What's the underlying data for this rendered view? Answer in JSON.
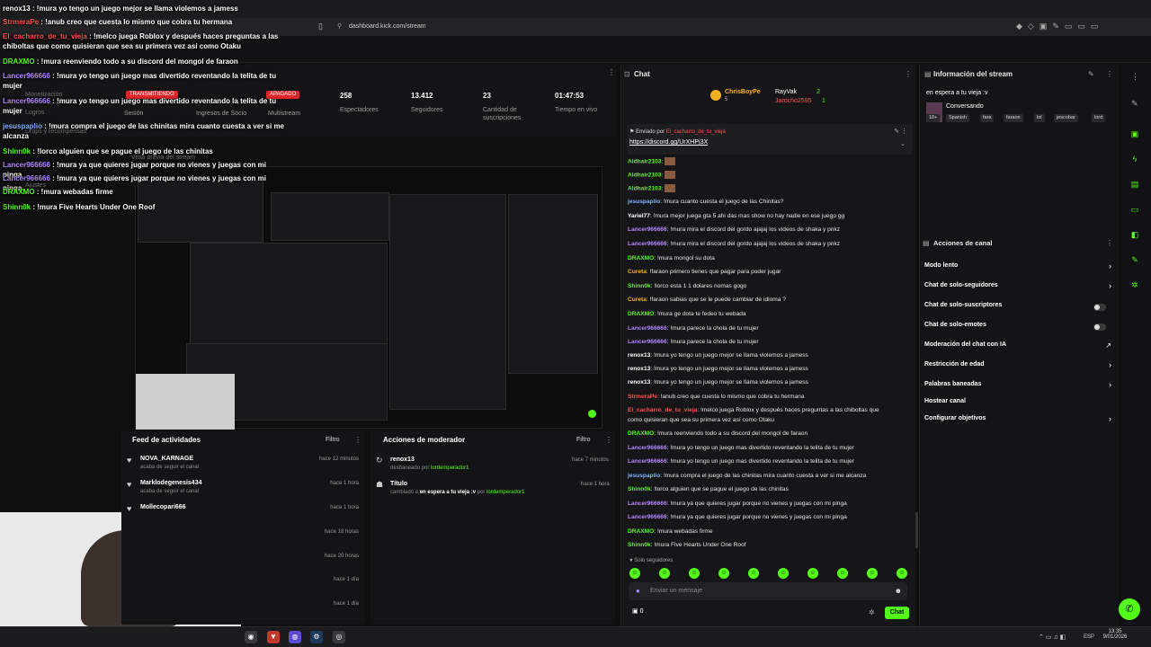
{
  "browser": {
    "url": "dashboard.kick.com/stream",
    "clock_time": "13:35",
    "clock_date": "9/01/2026",
    "lang": "ESP"
  },
  "sidebar_faded": {
    "items": [
      "Monetización",
      "Logros",
      "Drops y recompensas",
      "Vista previa del stream",
      "Ajustes"
    ]
  },
  "stats": {
    "badge_live": "TRANSMITIENDO",
    "badge_off": "APAGADO",
    "items": [
      {
        "value": "258",
        "label": "Espectadores"
      },
      {
        "value": "13.412",
        "label": "Seguidores"
      },
      {
        "value": "23",
        "label": "Cantidad de suscripciones"
      },
      {
        "value": "01:47:53",
        "label": "Tiempo en vivo"
      }
    ],
    "left_labels": [
      "Sesión",
      "Ingresos de Socio",
      "Multistream"
    ]
  },
  "overlay_chat": [
    {
      "user": "renox13",
      "text": "!mura yo tengo un juego mejor se llama violemos a jamess",
      "color": "#ffffff"
    },
    {
      "user": "StrmeraPe",
      "text": "!anub creo que cuesta lo mismo que cobra tu hermana",
      "color": "#ff5050"
    },
    {
      "user": "El_cacharro_de_tu_vieja",
      "text": "!melco juega Roblox y después haces preguntas a las chiboltas que como quisieran que sea su primera vez así como Otaku",
      "color": "#ff5050"
    },
    {
      "user": "DRAXMO",
      "text": "!mura reenviendo todo a su discord del mongol de faraon",
      "color": "#53fc18"
    },
    {
      "user": "Lancer966666",
      "text": "!mura yo tengo un juego mas divertido reventando la telita de tu mujer",
      "color": "#b388ff"
    },
    {
      "user": "Lancer966666",
      "text": "!mura yo tengo un juego mas divertido reventando la telita de tu mujer",
      "color": "#b388ff"
    },
    {
      "user": "jesuspaplio",
      "text": "!mura compra el juego de las chinitas mira cuanto cuesta a ver si me alcanza",
      "color": "#7fb3ff"
    },
    {
      "user": "Shinn0k",
      "text": "!lorco alguien que se pague el juego de las chinitas",
      "color": "#53fc18"
    },
    {
      "user": "Lancer966666",
      "text": "!mura ya que quieres jugar porque no vienes y juegas con mi pinga",
      "color": "#b388ff"
    },
    {
      "user": "Lancer966666",
      "text": "!mura ya que quieres jugar porque no vienes y juegas con mi pinga",
      "color": "#b388ff"
    },
    {
      "user": "DRAXMO",
      "text": "!mura webadas firme",
      "color": "#53fc18"
    },
    {
      "user": "Shinn0k",
      "text": "!mura Five Hearts Under One Roof",
      "color": "#53fc18"
    }
  ],
  "activity": {
    "title": "Feed de actividades",
    "filter": "Filtro",
    "rows": [
      {
        "name": "NOVA_KARNAGE",
        "sub": "acaba de seguir el canal",
        "time": "hace 12 minutos"
      },
      {
        "name": "Marklodegenesis434",
        "sub": "acaba de seguir el canal",
        "time": "hace 1 hora"
      },
      {
        "name": "Mollecopari666",
        "sub": "",
        "time": "hace 1 hora"
      },
      {
        "name": "",
        "sub": "",
        "time": "hace 18 horas"
      },
      {
        "name": "",
        "sub": "",
        "time": "hace 20 horas"
      },
      {
        "name": "",
        "sub": "",
        "time": "hace 1 día"
      },
      {
        "name": "",
        "sub": "",
        "time": "hace 1 día"
      }
    ]
  },
  "modactions": {
    "title": "Acciones de moderador",
    "filter": "Filtro",
    "rows": [
      {
        "name": "renox13",
        "sub_prefix": "desbaneado por",
        "sub_user": "lordemperador1",
        "time": "hace 7 minutos"
      },
      {
        "name": "Título",
        "sub_prefix": "cambiado a",
        "sub_value": "en espera a tu vieja :v",
        "sub_by": "por",
        "sub_user": "lordemperador1",
        "time": "hace 1 hora"
      }
    ]
  },
  "chat": {
    "title": "Chat",
    "top_users": [
      {
        "name": "ChrisBoyPe",
        "count": "5"
      },
      {
        "name": "RayVak",
        "count": "2"
      },
      {
        "name": "Jarocho2595",
        "count": "1"
      }
    ],
    "pinned_label": "Enviado por",
    "pinned_user": "El_cacharro_de_tu_vieja",
    "pinned_link": "https://discord.gg/UrXHPj3X",
    "messages": [
      {
        "user": "Aldhair2103",
        "text": "",
        "color": "#53fc18"
      },
      {
        "user": "Aldhair2103",
        "text": "",
        "color": "#53fc18"
      },
      {
        "user": "Aldhair2103",
        "text": "",
        "color": "#53fc18"
      },
      {
        "user": "jesuspaplio",
        "text": "!mura cuanto cuesta el juego de las Chinitas?",
        "color": "#7fb3ff"
      },
      {
        "user": "Yariel77",
        "text": "!mura mejor juega gta 5 ahi das mas show no hay nadie en ese juego gg",
        "color": "#ffffff"
      },
      {
        "user": "Lancer966666",
        "text": "!mura mira el discord del gordo ajajaj los videos de shaka y pnkz",
        "color": "#b388ff"
      },
      {
        "user": "Lancer966666",
        "text": "!mura mira el discord del gordo ajajaj los videos de shaka y pnkz",
        "color": "#b388ff"
      },
      {
        "user": "DRAXMO",
        "text": "!mura mongol su dota",
        "color": "#53fc18"
      },
      {
        "user": "Cureta",
        "text": "!faraon primero tienes que pagar para poder jugar",
        "color": "#ffb020"
      },
      {
        "user": "Shinn0k",
        "text": "!lorco esta 1 1 dolares nomas gogo",
        "color": "#53fc18"
      },
      {
        "user": "Cureta",
        "text": "!faraon sabias que se le puede cambiar de idioma ?",
        "color": "#ffb020"
      },
      {
        "user": "DRAXMO",
        "text": "!mura ge dota te fedeo tu webada",
        "color": "#53fc18"
      },
      {
        "user": "Lancer966666",
        "text": "!mura parece la chola de tu mujer",
        "color": "#b388ff"
      },
      {
        "user": "Lancer966666",
        "text": "!mura parece la chola de tu mujer",
        "color": "#b388ff"
      },
      {
        "user": "renox13",
        "text": "!mura yo tengo un juego mejor se llama violemos a jamess",
        "color": "#ffffff"
      },
      {
        "user": "renox13",
        "text": "!mura yo tengo un juego mejor se llama violemos a jamess",
        "color": "#ffffff"
      },
      {
        "user": "renox13",
        "text": "!mura yo tengo un juego mejor se llama violemos a jamess",
        "color": "#ffffff"
      },
      {
        "user": "StrmeraPe",
        "text": "!anub creo que cuesta lo mismo que cobra tu hermana",
        "color": "#ff5050"
      },
      {
        "user": "El_cacharro_de_tu_vieja",
        "text": "!melco juega Roblox y después haces preguntas a las chiboltas que",
        "color": "#ff5050"
      },
      {
        "user": "",
        "text": "como quisieran que sea su primera vez así como Otaku",
        "color": "#ffffff"
      },
      {
        "user": "DRAXMO",
        "text": "!mura reenviendo todo a su discord del mongol de faraon",
        "color": "#53fc18"
      },
      {
        "user": "Lancer966666",
        "text": "!mura yo tengo un juego mas divertido reventando la telita de tu mujer",
        "color": "#b388ff"
      },
      {
        "user": "Lancer966666",
        "text": "!mura yo tengo un juego mas divertido reventando la telita de tu mujer",
        "color": "#b388ff"
      },
      {
        "user": "jesuspaplio",
        "text": "!mura compra el juego de las chinitas mira cuanto cuesta a ver si me alcanza",
        "color": "#7fb3ff"
      },
      {
        "user": "Shinn0k",
        "text": "!lorco alguien que se pague el juego de las chinitas",
        "color": "#53fc18"
      },
      {
        "user": "Lancer966666",
        "text": "!mura ya que quieres jugar porque no vienes y juegas con mi pinga",
        "color": "#b388ff"
      },
      {
        "user": "Lancer966666",
        "text": "!mura ya que quieres jugar porque no vienes y juegas con mi pinga",
        "color": "#b388ff"
      },
      {
        "user": "DRAXMO",
        "text": "!mura webadas firme",
        "color": "#53fc18"
      },
      {
        "user": "Shinn0k",
        "text": "!mura Five Hearts Under One Roof",
        "color": "#53fc18"
      }
    ],
    "followers_only": "Solo seguidores",
    "input_placeholder": "Enviar un mensaje",
    "points": "0",
    "send_label": "Chat"
  },
  "info": {
    "title": "Información del stream",
    "stream_title": "en espera a tu vieja :v",
    "category": "Conversando",
    "tags": [
      "18+",
      "Spanish",
      "fara",
      "faraon",
      "lol",
      "jescobar",
      "lord"
    ],
    "actions_title": "Acciones de canal",
    "actions": [
      {
        "label": "Modo lento",
        "kind": "chevron"
      },
      {
        "label": "Chat de solo-seguidores",
        "kind": "chevron"
      },
      {
        "label": "Chat de solo-suscriptores",
        "kind": "toggle"
      },
      {
        "label": "Chat de solo-emotes",
        "kind": "toggle"
      },
      {
        "label": "Moderación del chat con IA",
        "kind": "external"
      },
      {
        "label": "Restricción de edad",
        "kind": "chevron"
      },
      {
        "label": "Palabras baneadas",
        "kind": "chevron"
      },
      {
        "label": "Hostear canal",
        "kind": "none"
      },
      {
        "label": "Configurar objetivos",
        "kind": "chevron"
      }
    ]
  },
  "colors": {
    "accent": "#53fc18",
    "bg": "#0f0f10",
    "panel": "#141416",
    "danger": "#e0262a"
  }
}
